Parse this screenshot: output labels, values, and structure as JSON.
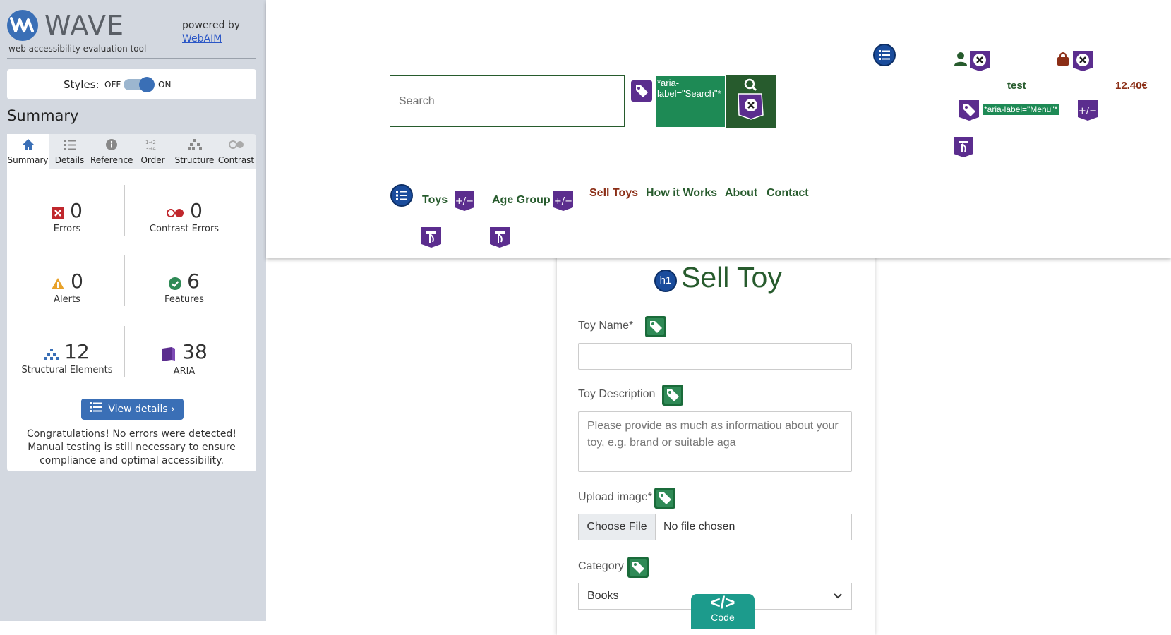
{
  "wave": {
    "title": "WAVE",
    "subtitle": "web accessibility evaluation tool",
    "powered_by": "powered by",
    "webaim_link": "WebAIM",
    "styles_label": "Styles:",
    "styles_off": "OFF",
    "styles_on": "ON",
    "summary_heading": "Summary",
    "tabs": [
      {
        "label": "Summary",
        "icon": "home-icon"
      },
      {
        "label": "Details",
        "icon": "list-icon"
      },
      {
        "label": "Reference",
        "icon": "info-icon"
      },
      {
        "label": "Order",
        "icon": "order-icon"
      },
      {
        "label": "Structure",
        "icon": "structure-icon"
      },
      {
        "label": "Contrast",
        "icon": "contrast-icon"
      }
    ],
    "stats": {
      "errors": {
        "value": "0",
        "label": "Errors",
        "color": "#c0272d"
      },
      "contrast_errors": {
        "value": "0",
        "label": "Contrast Errors",
        "color": "#c0272d"
      },
      "alerts": {
        "value": "0",
        "label": "Alerts",
        "color": "#e8a22a"
      },
      "features": {
        "value": "6",
        "label": "Features",
        "color": "#2f8a56"
      },
      "structural": {
        "value": "12",
        "label": "Structural Elements",
        "color": "#3a6fb6"
      },
      "aria": {
        "value": "38",
        "label": "ARIA",
        "color": "#5b2d8e"
      }
    },
    "view_details": "View details ›",
    "congrats": "Congratulations! No errors were detected! Manual testing is still necessary to ensure compliance and optimal accessibility."
  },
  "site": {
    "search": {
      "placeholder": "Search",
      "aria_annotation": "*aria-label=\"Search\"*"
    },
    "user": {
      "name": "test"
    },
    "cart": {
      "total": "12.40€"
    },
    "menu_aria_annotation": "*aria-label=\"Menu\"*",
    "nav": [
      "Toys",
      "Age Group",
      "Sell Toys",
      "How it Works",
      "About",
      "Contact"
    ],
    "active_nav": "Sell Toys",
    "colors": {
      "primary": "#275b2d",
      "accent": "#8b2e16",
      "aria_purple": "#5b2d8e"
    }
  },
  "form": {
    "heading_badge": "h1",
    "title": "Sell Toy",
    "toy_name_label": "Toy Name*",
    "toy_description_label": "Toy Description",
    "toy_description_placeholder": "Please provide as much as informatiou about your toy, e.g. brand or suitable aga",
    "upload_label": "Upload image*",
    "choose_file": "Choose File",
    "no_file": "No file chosen",
    "category_label": "Category",
    "category_value": "Books"
  },
  "code_button": {
    "label": "Code",
    "symbol": "</>"
  }
}
